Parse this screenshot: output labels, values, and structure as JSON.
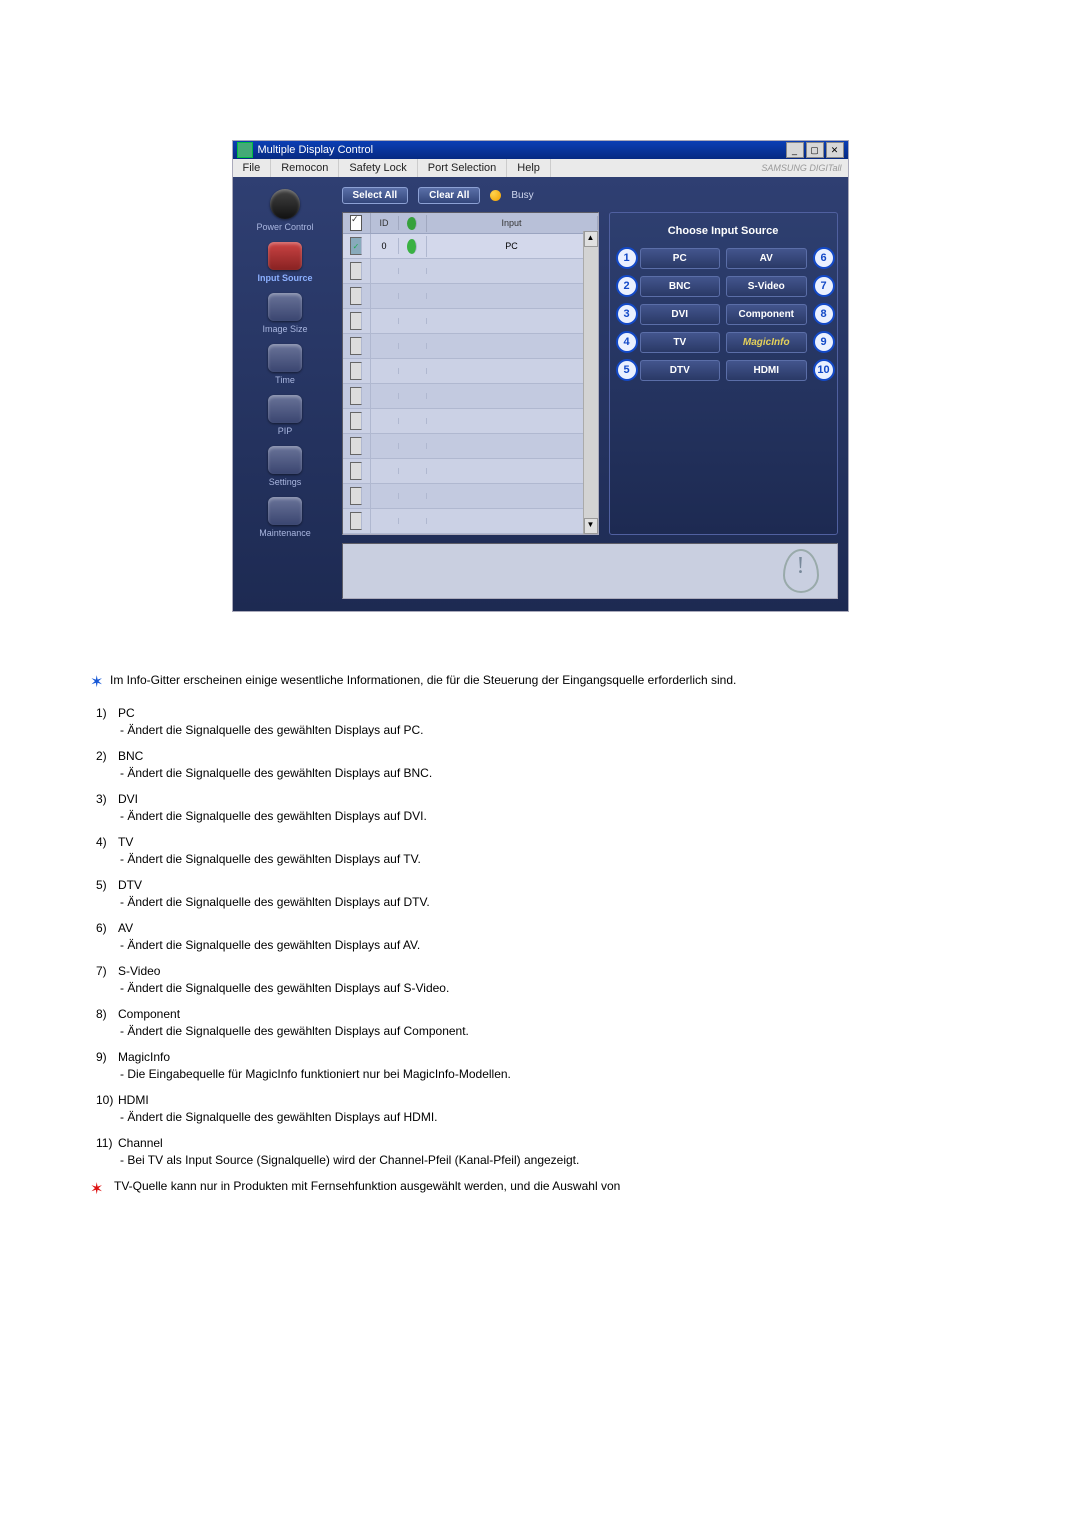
{
  "app": {
    "title": "Multiple Display Control",
    "brand": "SAMSUNG DIGITall",
    "menus": [
      "File",
      "Remocon",
      "Safety Lock",
      "Port Selection",
      "Help"
    ],
    "toolbar": {
      "select_all": "Select All",
      "clear_all": "Clear All",
      "busy": "Busy"
    },
    "grid": {
      "id_header": "ID",
      "input_header": "Input",
      "first_id": "0",
      "first_input": "PC"
    },
    "info_panel_title": "Choose Input Source",
    "sources_left": [
      {
        "n": "1",
        "label": "PC"
      },
      {
        "n": "2",
        "label": "BNC"
      },
      {
        "n": "3",
        "label": "DVI"
      },
      {
        "n": "4",
        "label": "TV"
      },
      {
        "n": "5",
        "label": "DTV"
      }
    ],
    "sources_right": [
      {
        "n": "6",
        "label": "AV"
      },
      {
        "n": "7",
        "label": "S-Video"
      },
      {
        "n": "8",
        "label": "Component"
      },
      {
        "n": "9",
        "label": "MagicInfo"
      },
      {
        "n": "10",
        "label": "HDMI"
      }
    ],
    "sidebar": [
      {
        "name": "Power Control",
        "key": "power"
      },
      {
        "name": "Input Source",
        "key": "input",
        "active": true
      },
      {
        "name": "Image Size",
        "key": "image"
      },
      {
        "name": "Time",
        "key": "time"
      },
      {
        "name": "PIP",
        "key": "pip"
      },
      {
        "name": "Settings",
        "key": "settings"
      },
      {
        "name": "Maintenance",
        "key": "maint"
      }
    ]
  },
  "intro": "Im Info-Gitter erscheinen einige wesentliche Informationen, die für die Steuerung der Eingangsquelle erforderlich sind.",
  "items": [
    {
      "n": "1)",
      "title": "PC",
      "desc": "- Ändert die Signalquelle des gewählten Displays auf PC."
    },
    {
      "n": "2)",
      "title": "BNC",
      "desc": "- Ändert die Signalquelle des gewählten Displays auf BNC."
    },
    {
      "n": "3)",
      "title": "DVI",
      "desc": "- Ändert die Signalquelle des gewählten Displays auf DVI."
    },
    {
      "n": "4)",
      "title": "TV",
      "desc": "- Ändert die Signalquelle des gewählten Displays auf TV."
    },
    {
      "n": "5)",
      "title": "DTV",
      "desc": "- Ändert die Signalquelle des gewählten Displays auf DTV."
    },
    {
      "n": "6)",
      "title": "AV",
      "desc": "- Ändert die Signalquelle des gewählten Displays auf AV."
    },
    {
      "n": "7)",
      "title": "S-Video",
      "desc": "- Ändert die Signalquelle des gewählten Displays auf S-Video."
    },
    {
      "n": "8)",
      "title": "Component",
      "desc": "- Ändert die Signalquelle des gewählten Displays auf Component."
    },
    {
      "n": "9)",
      "title": "MagicInfo",
      "desc": "- Die Eingabequelle für MagicInfo funktioniert nur bei MagicInfo-Modellen."
    },
    {
      "n": "10)",
      "title": "HDMI",
      "desc": "- Ändert die Signalquelle des gewählten Displays auf HDMI."
    },
    {
      "n": "11)",
      "title": "Channel",
      "desc": "- Bei TV als Input Source (Signalquelle) wird der Channel-Pfeil (Kanal-Pfeil) angezeigt."
    }
  ],
  "footnote": "TV-Quelle kann nur in Produkten mit Fernsehfunktion ausgewählt werden, und die Auswahl von"
}
